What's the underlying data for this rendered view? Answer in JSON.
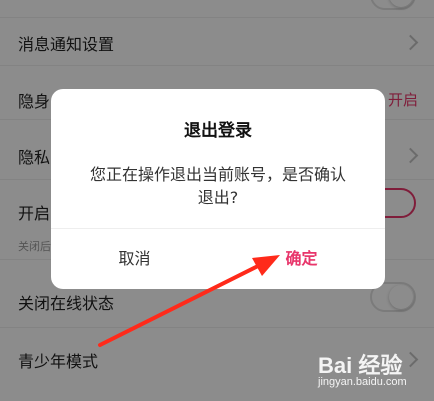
{
  "settings": {
    "items": [
      {
        "label": "消息通知设置"
      },
      {
        "label": "隐身",
        "value": "开启"
      },
      {
        "label": "隐私"
      },
      {
        "label": "开启",
        "sub": "关闭后"
      },
      {
        "label": "关闭在线状态"
      },
      {
        "label": "青少年模式"
      }
    ]
  },
  "dialog": {
    "title": "退出登录",
    "message_line1": "您正在操作退出当前账号，是否确认",
    "message_line2": "退出?",
    "cancel_label": "取消",
    "confirm_label": "确定"
  },
  "watermark": {
    "logo": "Bai 经验",
    "url": "jingyan.baidu.com"
  },
  "colors": {
    "accent": "#e8366b",
    "arrow": "#ff2a1a",
    "overlay": "rgba(0,0,0,0.45)"
  }
}
